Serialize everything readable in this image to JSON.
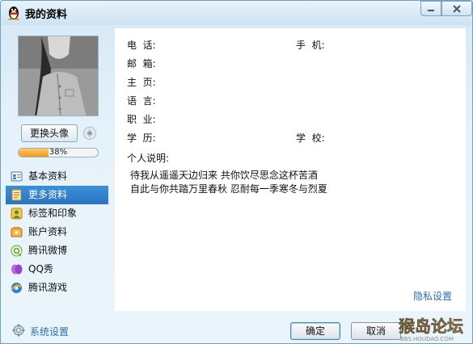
{
  "window": {
    "title": "我的资料",
    "app_icon": "qq-penguin-icon",
    "minimize_icon": "minimize-icon",
    "close_icon": "close-icon"
  },
  "profile": {
    "change_avatar_label": "更换头像",
    "camera_icon": "camera-icon",
    "completion_percent": 38,
    "completion_text": "38%"
  },
  "nav": {
    "items": [
      {
        "label": "基本资料",
        "icon": "id-card-icon",
        "active": false
      },
      {
        "label": "更多资料",
        "icon": "document-icon",
        "active": true
      },
      {
        "label": "标签和印象",
        "icon": "tag-person-icon",
        "active": false
      },
      {
        "label": "账户资料",
        "icon": "account-icon",
        "active": false
      },
      {
        "label": "腾讯微博",
        "icon": "weibo-icon",
        "active": false
      },
      {
        "label": "QQ秀",
        "icon": "qq-show-icon",
        "active": false
      },
      {
        "label": "腾讯游戏",
        "icon": "tencent-game-icon",
        "active": false
      }
    ]
  },
  "fields": {
    "phone": "电  话:",
    "mobile": "手  机:",
    "email": "邮  箱:",
    "homepage": "主  页:",
    "language": "语  言:",
    "occupation": "职  业:",
    "education": "学  历:",
    "school": "学  校:"
  },
  "description": {
    "title": "个人说明:",
    "line1": "待我从遥遥天边归来 共你饮尽思念这杯苦酒",
    "line2": "自此与你共踏万里春秋 忍耐每一季寒冬与烈夏"
  },
  "privacy_label": "隐私设置",
  "footer": {
    "settings_label": "系统设置",
    "settings_icon": "gear-icon",
    "ok_label": "确定",
    "cancel_label": "取消"
  },
  "watermark": {
    "title": "猴岛论坛",
    "url": "BBS.HOUDAO.COM"
  },
  "colors": {
    "accent": "#2b74c3",
    "link": "#2b6fb0",
    "progress": "#f29b18"
  }
}
